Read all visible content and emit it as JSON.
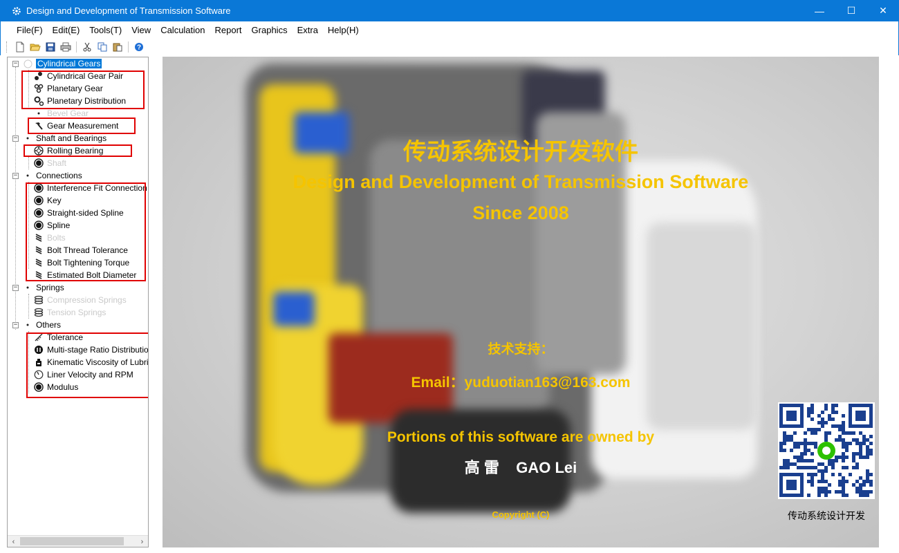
{
  "window": {
    "title": "Design and Development of Transmission Software",
    "minimize": "—",
    "maximize": "☐",
    "close": "✕"
  },
  "menu": [
    "File(F)",
    "Edit(E)",
    "Tools(T)",
    "View",
    "Calculation",
    "Report",
    "Graphics",
    "Extra",
    "Help(H)"
  ],
  "toolbar": {
    "icons": [
      "new-file-icon",
      "open-folder-icon",
      "save-icon",
      "print-icon",
      "cut-icon",
      "copy-icon",
      "paste-icon",
      "help-icon"
    ]
  },
  "tree": {
    "cylindrical_gears": "Cylindrical Gears",
    "cylindrical_gear_pair": "Cylindrical Gear Pair",
    "planetary_gear": "Planetary Gear",
    "planetary_distribution": "Planetary Distribution",
    "bevel_gear": "Bevel Gear",
    "gear_measurement": "Gear Measurement",
    "shaft_and_bearings": "Shaft and Bearings",
    "rolling_bearing": "Rolling Bearing",
    "shaft": "Shaft",
    "connections": "Connections",
    "interference_fit": "Interference Fit Connection",
    "key": "Key",
    "straight_sided_spline": "Straight-sided Spline",
    "spline": "Spline",
    "bolts": "Bolts",
    "bolt_thread_tolerance": "Bolt Thread Tolerance",
    "bolt_tightening_torque": "Bolt Tightening Torque",
    "estimated_bolt_diameter": "Estimated Bolt Diameter",
    "springs": "Springs",
    "compression_springs": "Compression Springs",
    "tension_springs": "Tension Springs",
    "others": "Others",
    "tolerance": "Tolerance",
    "multi_stage_ratio": "Multi-stage Ratio Distribution",
    "kinematic_viscosity": "Kinematic Viscosity of Lubricant",
    "liner_velocity": "Liner Velocity and RPM",
    "modulus": "Modulus"
  },
  "splash": {
    "title_cn": "传动系统设计开发软件",
    "title_en": "Design and Development of Transmission Software",
    "since": "Since 2008",
    "support_cn": "技术支持：",
    "email": "Email：yuduotian163@163.com",
    "portions": "Portions of this software are owned by",
    "author": "高 雷    GAO Lei",
    "copyright": "Copyright (C)",
    "qr_caption": "传动系统设计开发",
    "accent_color": "#f5c400"
  }
}
